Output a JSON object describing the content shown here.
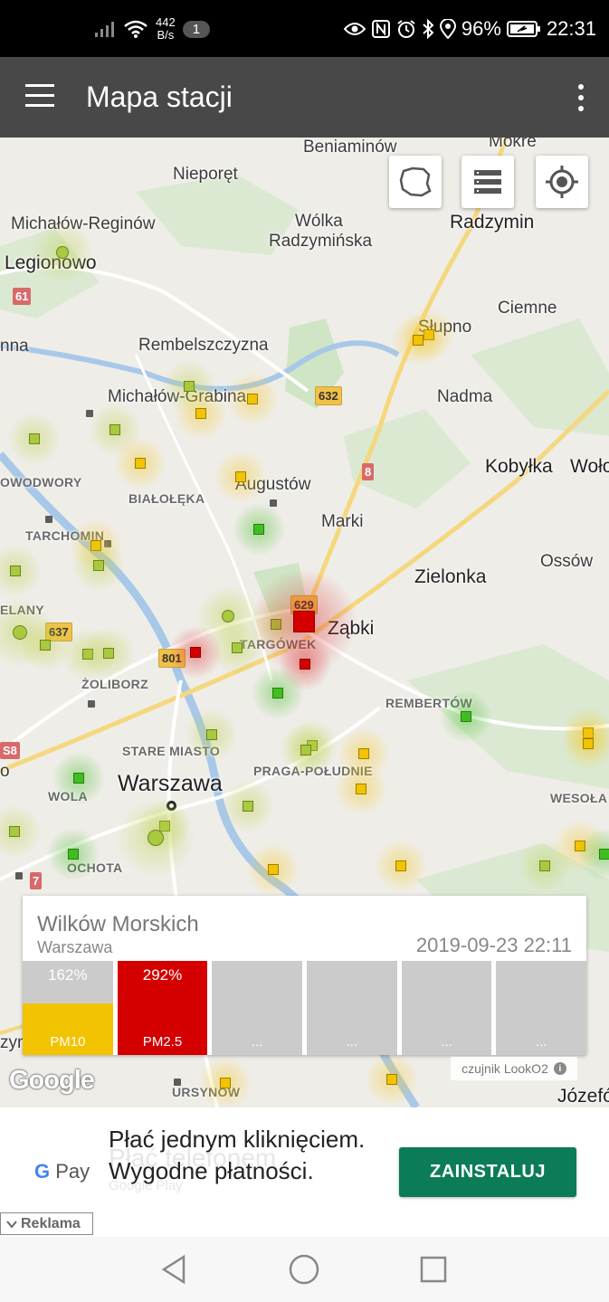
{
  "status_bar": {
    "net_speed_value": "442",
    "net_speed_unit": "B/s",
    "notification_count": "1",
    "battery": "96%",
    "time": "22:31"
  },
  "app_bar": {
    "title": "Mapa stacji"
  },
  "map": {
    "places": {
      "beniaminow": "Beniaminów",
      "mokre": "Mokre",
      "nieporet": "Nieporęt",
      "michalow_reginow": "Michałów-Reginów",
      "wolka_radzyminska_1": "Wólka",
      "wolka_radzyminska_2": "Radzymińska",
      "radzymin": "Radzymin",
      "legionowo": "Legionowo",
      "ciemne": "Ciemne",
      "nna": "nna",
      "rembelszczyzna": "Rembelszczyzna",
      "slupno": "Słupno",
      "michalow_grabina": "Michałów-Grabina",
      "nadma": "Nadma",
      "owodwory": "OWODWORY",
      "kobylka": "Kobyłka",
      "wolo": "Woło",
      "augustow": "Augustów",
      "bialoleka": "BIAŁOŁĘKA",
      "marki": "Marki",
      "tarchomin": "TARCHOMIN",
      "zielonka": "Zielonka",
      "ossow": "Ossów",
      "elany": "ELANY",
      "zabki": "Ząbki",
      "targowek": "TARGÓWEK",
      "zoliborz": "ŻOLIBORZ",
      "rembertow": "REMBERTÓW",
      "stare_miasto": "STARE MIASTO",
      "praga_poludnie": "PRAGA-POŁUDNIE",
      "warszawa": "Warszawa",
      "wola": "WOLA",
      "wesola": "WESOŁA",
      "ochota": "OCHOTA",
      "ursynow": "URSYNÓW",
      "jozef": "Józefó",
      "zyn": "zyn",
      "o": "o"
    },
    "road_shields": {
      "r61": "61",
      "r632": "632",
      "r8": "8",
      "r637": "637",
      "r629": "629",
      "r801": "801",
      "rs8": "S8",
      "r7": "7"
    },
    "level_colors": {
      "green": "#3fbf1f",
      "yellowgreen": "#a9c93e",
      "yellow": "#f2c300",
      "red": "#d40000"
    },
    "google_logo": "Google",
    "sensor_badge": "czujnik LookO2",
    "info_icon": "i"
  },
  "station_card": {
    "name": "Wilków Morskich",
    "city": "Warszawa",
    "timestamp": "2019-09-23 22:11",
    "bars": [
      {
        "label": "PM10",
        "percent_text": "162%",
        "fill_fraction": 0.55,
        "color": "#f2c300"
      },
      {
        "label": "PM2.5",
        "percent_text": "292%",
        "fill_fraction": 1.0,
        "color": "#d40000"
      },
      {
        "label": "...",
        "percent_text": "",
        "fill_fraction": 0,
        "color": "#cbcbcb"
      },
      {
        "label": "...",
        "percent_text": "",
        "fill_fraction": 0,
        "color": "#cbcbcb"
      },
      {
        "label": "...",
        "percent_text": "",
        "fill_fraction": 0,
        "color": "#cbcbcb"
      },
      {
        "label": "...",
        "percent_text": "",
        "fill_fraction": 0,
        "color": "#cbcbcb"
      }
    ]
  },
  "ad": {
    "brand_g": "G",
    "brand_pay": "Pay",
    "headline": "Płać jednym kliknięciem. Wygodne płatności.",
    "ghost_text": "Płać telefonem",
    "ghost_text_2": "Google Play",
    "install_label": "ZAINSTALUJ",
    "ad_label": "Reklama"
  }
}
